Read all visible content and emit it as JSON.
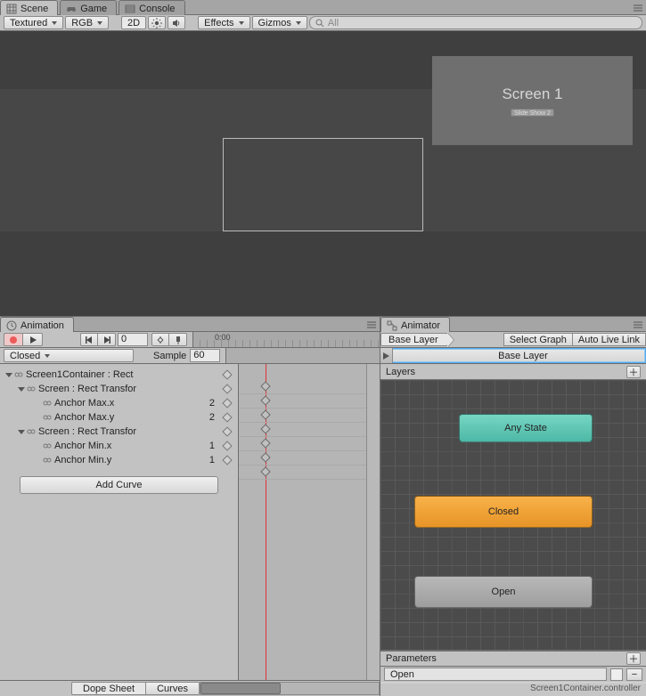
{
  "top_tabs": {
    "scene": "Scene",
    "game": "Game",
    "console": "Console"
  },
  "scene_toolbar": {
    "shading": "Textured",
    "render": "RGB",
    "mode2d": "2D",
    "effects": "Effects",
    "gizmos": "Gizmos",
    "search_placeholder": "All"
  },
  "scene_view": {
    "panel_title": "Screen 1",
    "panel_button": "Slide Show 2"
  },
  "animation": {
    "tab": "Animation",
    "frame": "0",
    "clip": "Closed",
    "sample_label": "Sample",
    "sample_value": "60",
    "ruler": "0:00",
    "hierarchy": [
      {
        "level": 0,
        "label": "Screen1Container : Rect",
        "fold": true,
        "open": true
      },
      {
        "level": 1,
        "label": "Screen : Rect Transfor",
        "fold": true,
        "open": true
      },
      {
        "level": 2,
        "label": "Anchor Max.x",
        "value": "2"
      },
      {
        "level": 2,
        "label": "Anchor Max.y",
        "value": "2"
      },
      {
        "level": 1,
        "label": "Screen : Rect Transfor",
        "fold": true,
        "open": true
      },
      {
        "level": 2,
        "label": "Anchor Min.x",
        "value": "1"
      },
      {
        "level": 2,
        "label": "Anchor Min.y",
        "value": "1"
      }
    ],
    "add_curve": "Add Curve",
    "footer": {
      "dope": "Dope Sheet",
      "curves": "Curves"
    }
  },
  "animator": {
    "tab": "Animator",
    "breadcrumb": "Base Layer",
    "select_graph": "Select Graph",
    "auto_live": "Auto Live Link",
    "layer_dropdown": "Base Layer",
    "layers_label": "Layers",
    "nodes": {
      "any": "Any State",
      "closed": "Closed",
      "open": "Open"
    },
    "params_label": "Parameters",
    "param_name": "Open",
    "status": "Screen1Container.controller"
  }
}
